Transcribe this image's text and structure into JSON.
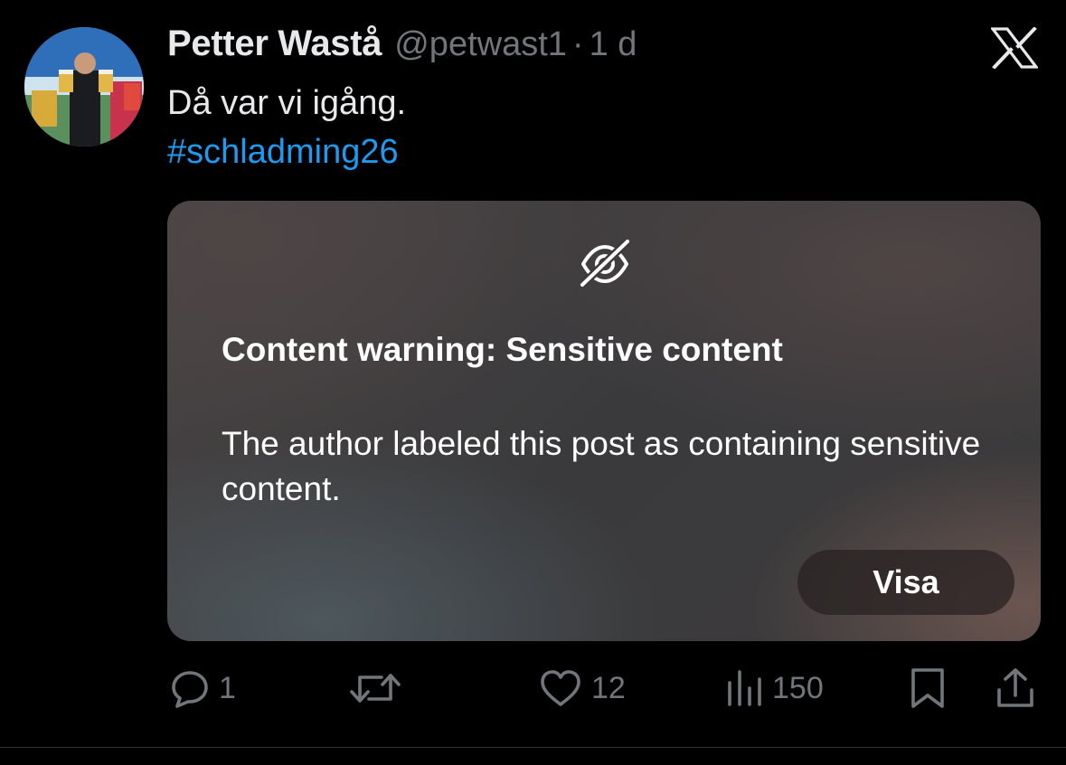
{
  "tweet": {
    "author": {
      "display_name": "Petter Wastå",
      "handle": "@petwast1",
      "separator": "·",
      "time": "1 d"
    },
    "text": "Då var vi igång.",
    "hashtag": "#schladming26"
  },
  "content_warning": {
    "icon": "eye-slash-icon",
    "title": "Content warning: Sensitive content",
    "body": "The author labeled this post as containing sensitive content.",
    "show_button_label": "Visa"
  },
  "actions": {
    "reply_count": "1",
    "repost_count": "",
    "like_count": "12",
    "view_count": "150"
  },
  "colors": {
    "background": "#000000",
    "text_primary": "#e7e9ea",
    "text_secondary": "#71767b",
    "link": "#1d9bf0"
  }
}
